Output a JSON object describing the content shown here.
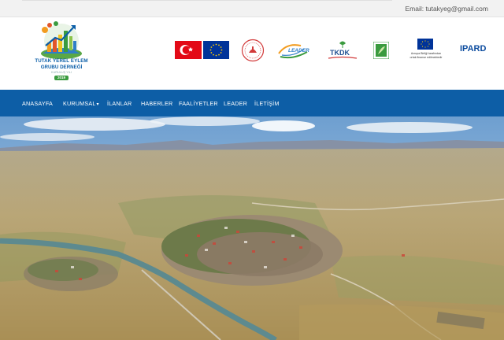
{
  "topbar": {
    "email": "Email: tutakyeg@gmail.com"
  },
  "logo": {
    "line1": "TUTAK YEREL EYLEM",
    "line2": "GRUBU DERNEĞİ",
    "line3": "KURULUŞ YILI",
    "year": "2019"
  },
  "partners": {
    "leader_label": "LEADER",
    "tkdk_label": "TKDK",
    "eu_funding_line1": "Avrupa Birliği tarafından",
    "eu_funding_line2": "ortak finanse edilmektedir",
    "ipard_label": "IPARD"
  },
  "nav": {
    "items": [
      {
        "label": "ANASAYFA"
      },
      {
        "label": "KURUMSAL"
      },
      {
        "label": "İLANLAR"
      },
      {
        "label": "HABERLER"
      },
      {
        "label": "FAALİYETLER"
      },
      {
        "label": "LEADER"
      },
      {
        "label": "İLETİŞİM"
      }
    ],
    "dropdown_caret": "▾"
  },
  "colors": {
    "nav_background": "#0d5ea6",
    "topbar_background": "#f2f2f2",
    "logo_text": "#0b5ea8",
    "turkish_red": "#e30a17",
    "eu_blue": "#003399"
  },
  "hero": {
    "image": "aerial-photo-of-town-in-valley"
  }
}
